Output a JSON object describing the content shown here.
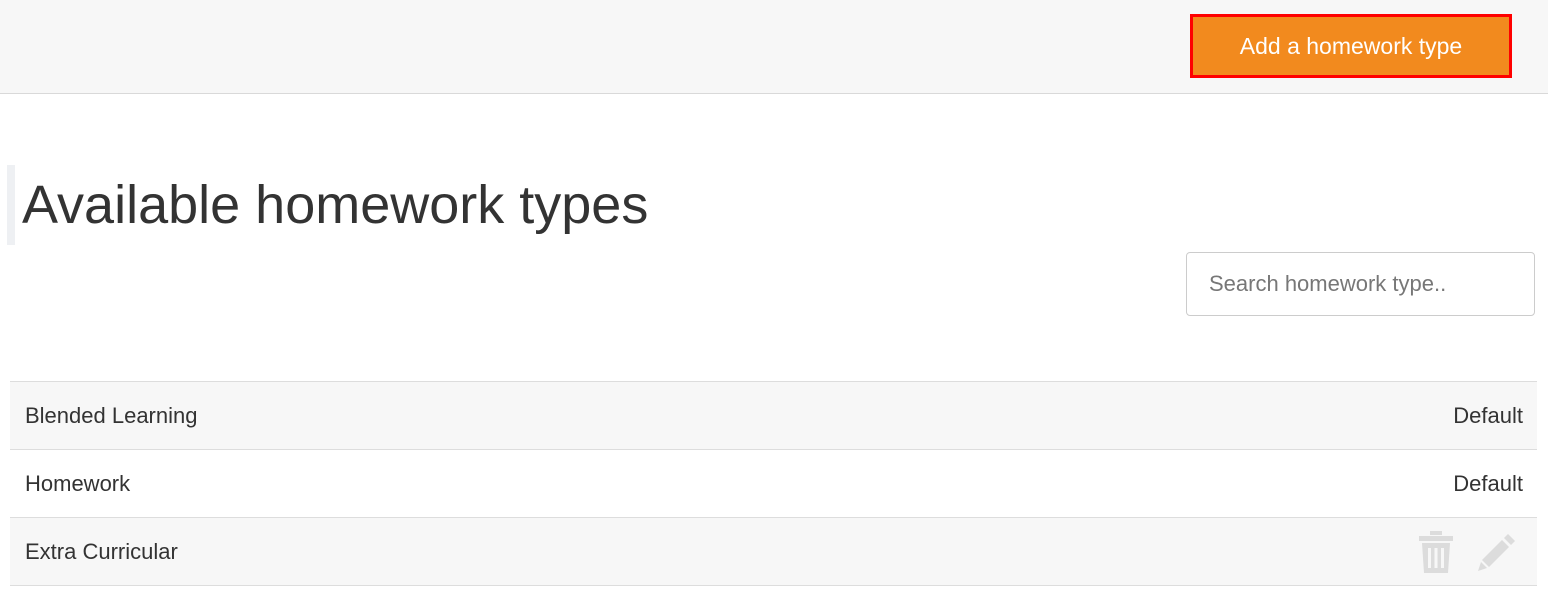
{
  "header": {
    "add_button_label": "Add a homework type"
  },
  "page": {
    "title": "Available homework types"
  },
  "search": {
    "placeholder": "Search homework type..",
    "value": ""
  },
  "homework_types": [
    {
      "name": "Blended Learning",
      "status": "Default"
    },
    {
      "name": "Homework",
      "status": "Default"
    },
    {
      "name": "Extra Curricular",
      "status": "",
      "actions": [
        "trash-icon",
        "pencil-icon"
      ]
    }
  ],
  "colors": {
    "accent": "#f28a1e",
    "highlight_border": "#ff0000",
    "row_shade": "#f7f7f7",
    "icon_gray": "#dcdcdc"
  }
}
